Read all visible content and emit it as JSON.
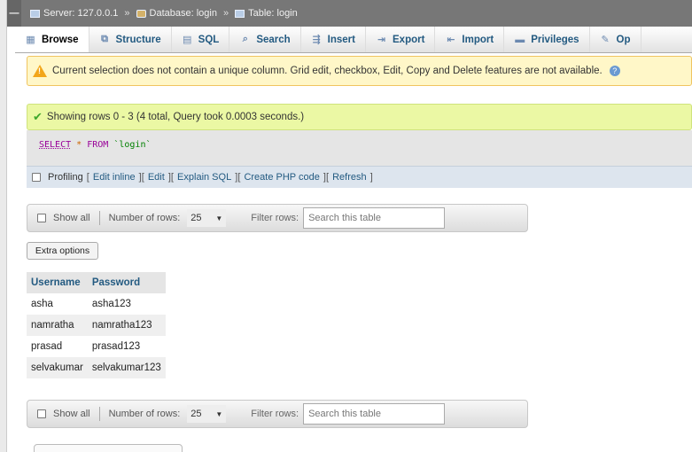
{
  "breadcrumb": {
    "server_label": "Server: 127.0.0.1",
    "database_label": "Database: login",
    "table_label": "Table: login",
    "separator": "»"
  },
  "tabs": [
    {
      "label": "Browse",
      "icon": "browse-icon",
      "glyph": "▦",
      "active": true
    },
    {
      "label": "Structure",
      "icon": "structure-icon",
      "glyph": "⧉",
      "active": false
    },
    {
      "label": "SQL",
      "icon": "sql-icon",
      "glyph": "▤",
      "active": false
    },
    {
      "label": "Search",
      "icon": "search-icon",
      "glyph": "⌕",
      "active": false
    },
    {
      "label": "Insert",
      "icon": "insert-icon",
      "glyph": "⇶",
      "active": false
    },
    {
      "label": "Export",
      "icon": "export-icon",
      "glyph": "⇥",
      "active": false
    },
    {
      "label": "Import",
      "icon": "import-icon",
      "glyph": "⇤",
      "active": false
    },
    {
      "label": "Privileges",
      "icon": "privileges-icon",
      "glyph": "▬",
      "active": false
    },
    {
      "label": "Op",
      "icon": "operations-icon",
      "glyph": "✎",
      "active": false
    }
  ],
  "notice": {
    "text": "Current selection does not contain a unique column. Grid edit, checkbox, Edit, Copy and Delete features are not available."
  },
  "success": {
    "text": "Showing rows 0 - 3 (4 total, Query took 0.0003 seconds.)"
  },
  "sql": {
    "select": "SELECT",
    "star": "*",
    "from": "FROM",
    "table": "`login`"
  },
  "profiling": {
    "label": "Profiling",
    "links": [
      "Edit inline",
      "Edit",
      "Explain SQL",
      "Create PHP code",
      "Refresh"
    ]
  },
  "navigation": {
    "show_all": "Show all",
    "rows_label": "Number of rows:",
    "rows_value": "25",
    "filter_label": "Filter rows:",
    "filter_placeholder": "Search this table"
  },
  "extra_options": "Extra options",
  "results": {
    "columns": [
      "Username",
      "Password"
    ],
    "rows": [
      [
        "asha",
        "asha123"
      ],
      [
        "namratha",
        "namratha123"
      ],
      [
        "prasad",
        "prasad123"
      ],
      [
        "selvakumar",
        "selvakumar123"
      ]
    ]
  },
  "colors": {
    "topbar": "#777777",
    "link": "#235a81",
    "notice_bg": "#fff7c8",
    "success_bg": "#ebf8a4"
  }
}
